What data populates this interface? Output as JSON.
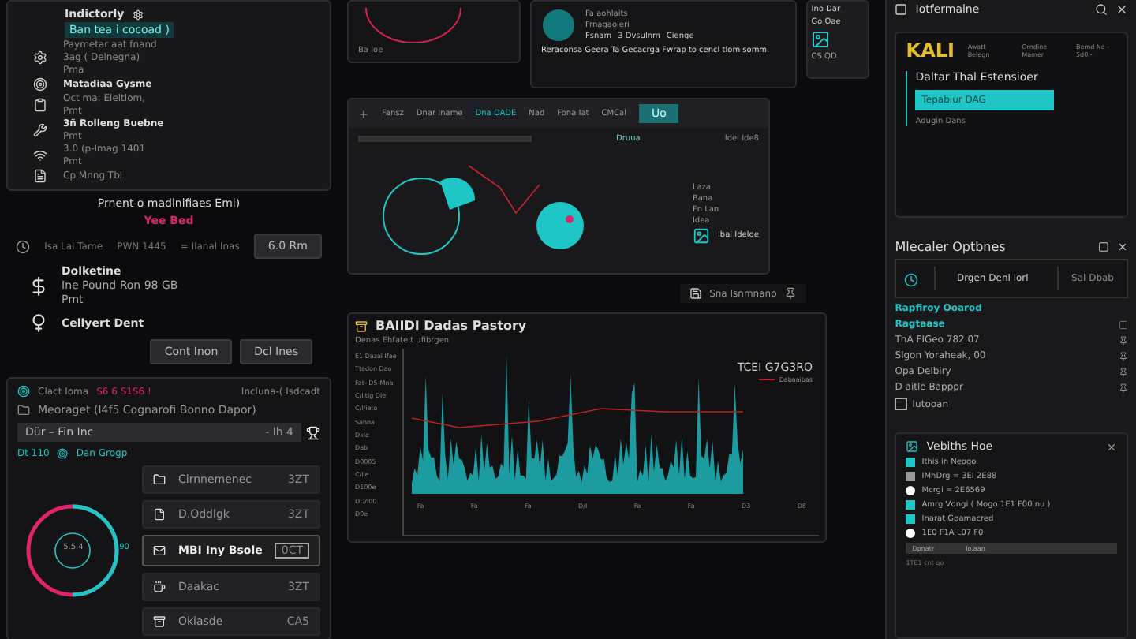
{
  "log_panel": {
    "title": "Indictorly",
    "badge": "Ban tea i cocoad )",
    "items": [
      {
        "kind": "gear",
        "lines": [
          {
            "text": "Paymetar aat fnand",
            "bold": false
          },
          {
            "text": "3ag ( Delnegna)",
            "bold": false
          },
          {
            "text": "Pma",
            "bold": false
          }
        ]
      },
      {
        "kind": "target",
        "lines": [
          {
            "text": "Matadiaa Gysme",
            "bold": true
          }
        ]
      },
      {
        "kind": "clipboard",
        "lines": [
          {
            "text": "Oct ma: Eleltlom,",
            "bold": false
          },
          {
            "text": "Pmt",
            "bold": false
          }
        ]
      },
      {
        "kind": "tools",
        "lines": [
          {
            "text": "3ñ Rolleng Buebne",
            "bold": true
          },
          {
            "text": "Pmt",
            "bold": false
          }
        ]
      },
      {
        "kind": "wifi",
        "lines": [
          {
            "text": "3.0 (p-Imag 1401",
            "bold": false
          },
          {
            "text": "Pmt",
            "bold": false
          }
        ]
      },
      {
        "kind": "doc",
        "lines": [
          {
            "text": "Cp Mnng Tbl",
            "bold": false
          }
        ]
      }
    ],
    "note": "Prnent o madlnifiaes Emi)",
    "alert": "Yee Bed",
    "info_row": [
      "Isa Lal Tame",
      "PWN 1445",
      "= Ilanal Inas"
    ],
    "info_button": "6.0 Rm",
    "entries": [
      {
        "kind": "dollar",
        "title": "Dolketine",
        "lines": [
          "Ine Pound Ron 98 GB",
          "Pmt"
        ]
      },
      {
        "kind": "gender",
        "title": "Cellyert Dent"
      }
    ],
    "buttons": [
      "Cont Inon",
      "Dcl Ines"
    ]
  },
  "files_panel": {
    "status": "Clact Ioma",
    "code": "S6 6 S1S6 !",
    "right": "Incluna-( Isdcadt",
    "caption": "Meoraget (I4f5 Cognarofi Bonno Dapor)",
    "path": "Dür – Fin Inc",
    "path_extra": "- Ih 4",
    "group_a": "Dt 110",
    "group_b": "Dan Grogp",
    "ring_label": "5.5.4",
    "ring_side": "90",
    "items": [
      {
        "name": "Cirnnemenec",
        "size": "3ZT",
        "selected": false
      },
      {
        "name": "D.Oddlgk",
        "size": "3ZT",
        "selected": false
      },
      {
        "name": "MBI Iny Bsole",
        "size": "0CT",
        "selected": true
      },
      {
        "name": "Daakac",
        "size": "3ZT",
        "selected": false
      },
      {
        "name": "Okiasde",
        "size": "CA5",
        "selected": false
      }
    ]
  },
  "mini_window": {
    "label": "Ba Ioe"
  },
  "preview_window": {
    "labels": [
      "Fa aohlaits",
      "Frnagaoleri"
    ],
    "row": [
      "Fsnam",
      "3 Dvsulnm",
      "Cienge"
    ],
    "hint": "Reraconsa Geera Ta Gecacrga Fwrap to cencl tlom somm."
  },
  "side_card": {
    "lines": [
      "Ino Dar",
      "Go Oae"
    ],
    "foot": "CS QD"
  },
  "editor": {
    "toolbar": [
      "Fansz",
      "Dnar Iname",
      "Dna DADE",
      "Nad",
      "Fona Iat",
      "CMCal"
    ],
    "tab": "Uo",
    "tab_below": "Druua",
    "search_right": "Idel Ide8",
    "aside": "Ibal Idelde",
    "node_labels": [
      "Laza",
      "Bana",
      "Fn Lan",
      "Idea"
    ]
  },
  "status_chip": "Sna Isnmnano",
  "history": {
    "title": "BAIIDI Dadas Pastory",
    "subtitle": "Denas Ehfate t  ufibrgen",
    "legend_title": "TCEI G7G3RO",
    "legend_item": "Dabaaibas",
    "y_labels": [
      "E1 Dazal Ifae",
      "Ttadon Dao",
      "Fat- D5-Mna",
      "C/lItlg Dle",
      "C/l/ieto",
      "Sahna",
      "Dkie",
      "Dab",
      "D0005",
      "C/lle",
      "D100e",
      "DD/l00",
      "D0e"
    ],
    "x_labels": [
      "Fa",
      "Fa",
      "Fa",
      "D/I",
      "Fa",
      "Fa",
      "D3",
      "D8"
    ]
  },
  "info_panel": {
    "title": "Iotfermaine",
    "logo": "KALI",
    "columns": [
      "Awatt Belegn",
      "Orndine Mamer",
      "Bemd Ne - 5d0 -"
    ],
    "heading": "Daltar Thal Estensioer",
    "highlight": "Tepabiur DAG",
    "sub": "Adugin Dans"
  },
  "options_panel": {
    "title": "Mlecaler Optbnes",
    "tabs": [
      {
        "label": "Drgen Denl lorl",
        "selected": true
      },
      {
        "label": "Sal Dbab",
        "selected": false
      }
    ],
    "section": "Rapfiroy Ooarod",
    "subsection": "Ragtaase",
    "items": [
      {
        "text": "ThA FIGeo   782.07"
      },
      {
        "text": "Slgon Yoraheak, 00"
      },
      {
        "text": "Opa Delbiry"
      },
      {
        "text": "D aitle Bapppr"
      }
    ],
    "checkbox": {
      "label": "Iutooan",
      "checked": false
    }
  },
  "legend_panel": {
    "title": "Vebiths Hoe",
    "items": [
      {
        "text": "Ithis in Neogo",
        "color": "#1fc6c6"
      },
      {
        "text": "IMhDrg = 3EI 2E88",
        "color": "#9a9a9a"
      },
      {
        "text": "Mcrgi = 2E6569",
        "color": "#ffffff"
      },
      {
        "text": "Amrg Vdngi ( Mogo 1E1 F00 nu )",
        "color": "#1fc6c6"
      },
      {
        "text": "Inarat Gpamacred",
        "color": "#1fc6c6"
      },
      {
        "text": "1E0 F1A L07 F0",
        "color": "#ffffff"
      }
    ],
    "footer": [
      "Dpnatr",
      "Io.aan"
    ],
    "footnote": "1TE1 cnt go"
  }
}
